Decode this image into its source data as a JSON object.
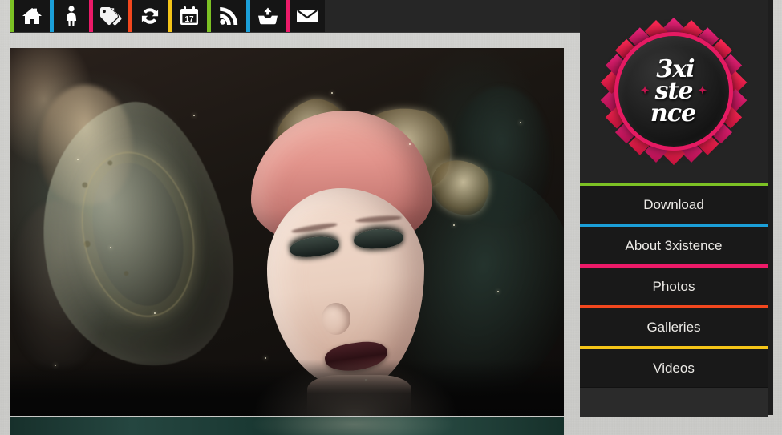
{
  "site": {
    "name": "3xistence",
    "background_color": "#c9c9c5",
    "panel_color": "#242424"
  },
  "toolbar": {
    "background": "#1b1b1b",
    "items": [
      {
        "icon": "home-icon",
        "label": "Home",
        "separator_color": "#7cc124"
      },
      {
        "icon": "person-icon",
        "label": "Profile",
        "separator_color": "#1b9fd8"
      },
      {
        "icon": "tags-icon",
        "label": "Tags",
        "separator_color": "#ec1a68"
      },
      {
        "icon": "refresh-icon",
        "label": "Refresh",
        "separator_color": "#f2471e"
      },
      {
        "icon": "calendar-icon",
        "label": "Calendar",
        "separator_color": "#f5c518",
        "day": "17"
      },
      {
        "icon": "rss-icon",
        "label": "Feed",
        "separator_color": "#7cc124"
      },
      {
        "icon": "upload-icon",
        "label": "Upload",
        "separator_color": "#1b9fd8"
      },
      {
        "icon": "mail-icon",
        "label": "Mail",
        "separator_color": "#ec1a68"
      }
    ]
  },
  "logo": {
    "line1": "3xi",
    "line2": "ste",
    "line3": "nce",
    "star_left": "✦",
    "star_right": "✦",
    "ring_color": "#e51a62",
    "ray_color_top": "#e8247a",
    "ray_color_bottom": "#ff2a55"
  },
  "nav": {
    "items": [
      {
        "label": "Download",
        "accent": "#7cc124"
      },
      {
        "label": "About 3xistence",
        "accent": "#1b9fd8"
      },
      {
        "label": "Photos",
        "accent": "#ec1a68"
      },
      {
        "label": "Galleries",
        "accent": "#f2471e"
      },
      {
        "label": "Videos",
        "accent": "#f5c518"
      }
    ]
  },
  "gallery": {
    "photos": [
      {
        "name": "fairy-portrait",
        "alt": "Close-up of a CGI fairy with pink hair, butterfly headpiece and translucent wings"
      },
      {
        "name": "second-photo",
        "alt": "Dark teal photograph partially visible below"
      }
    ]
  }
}
